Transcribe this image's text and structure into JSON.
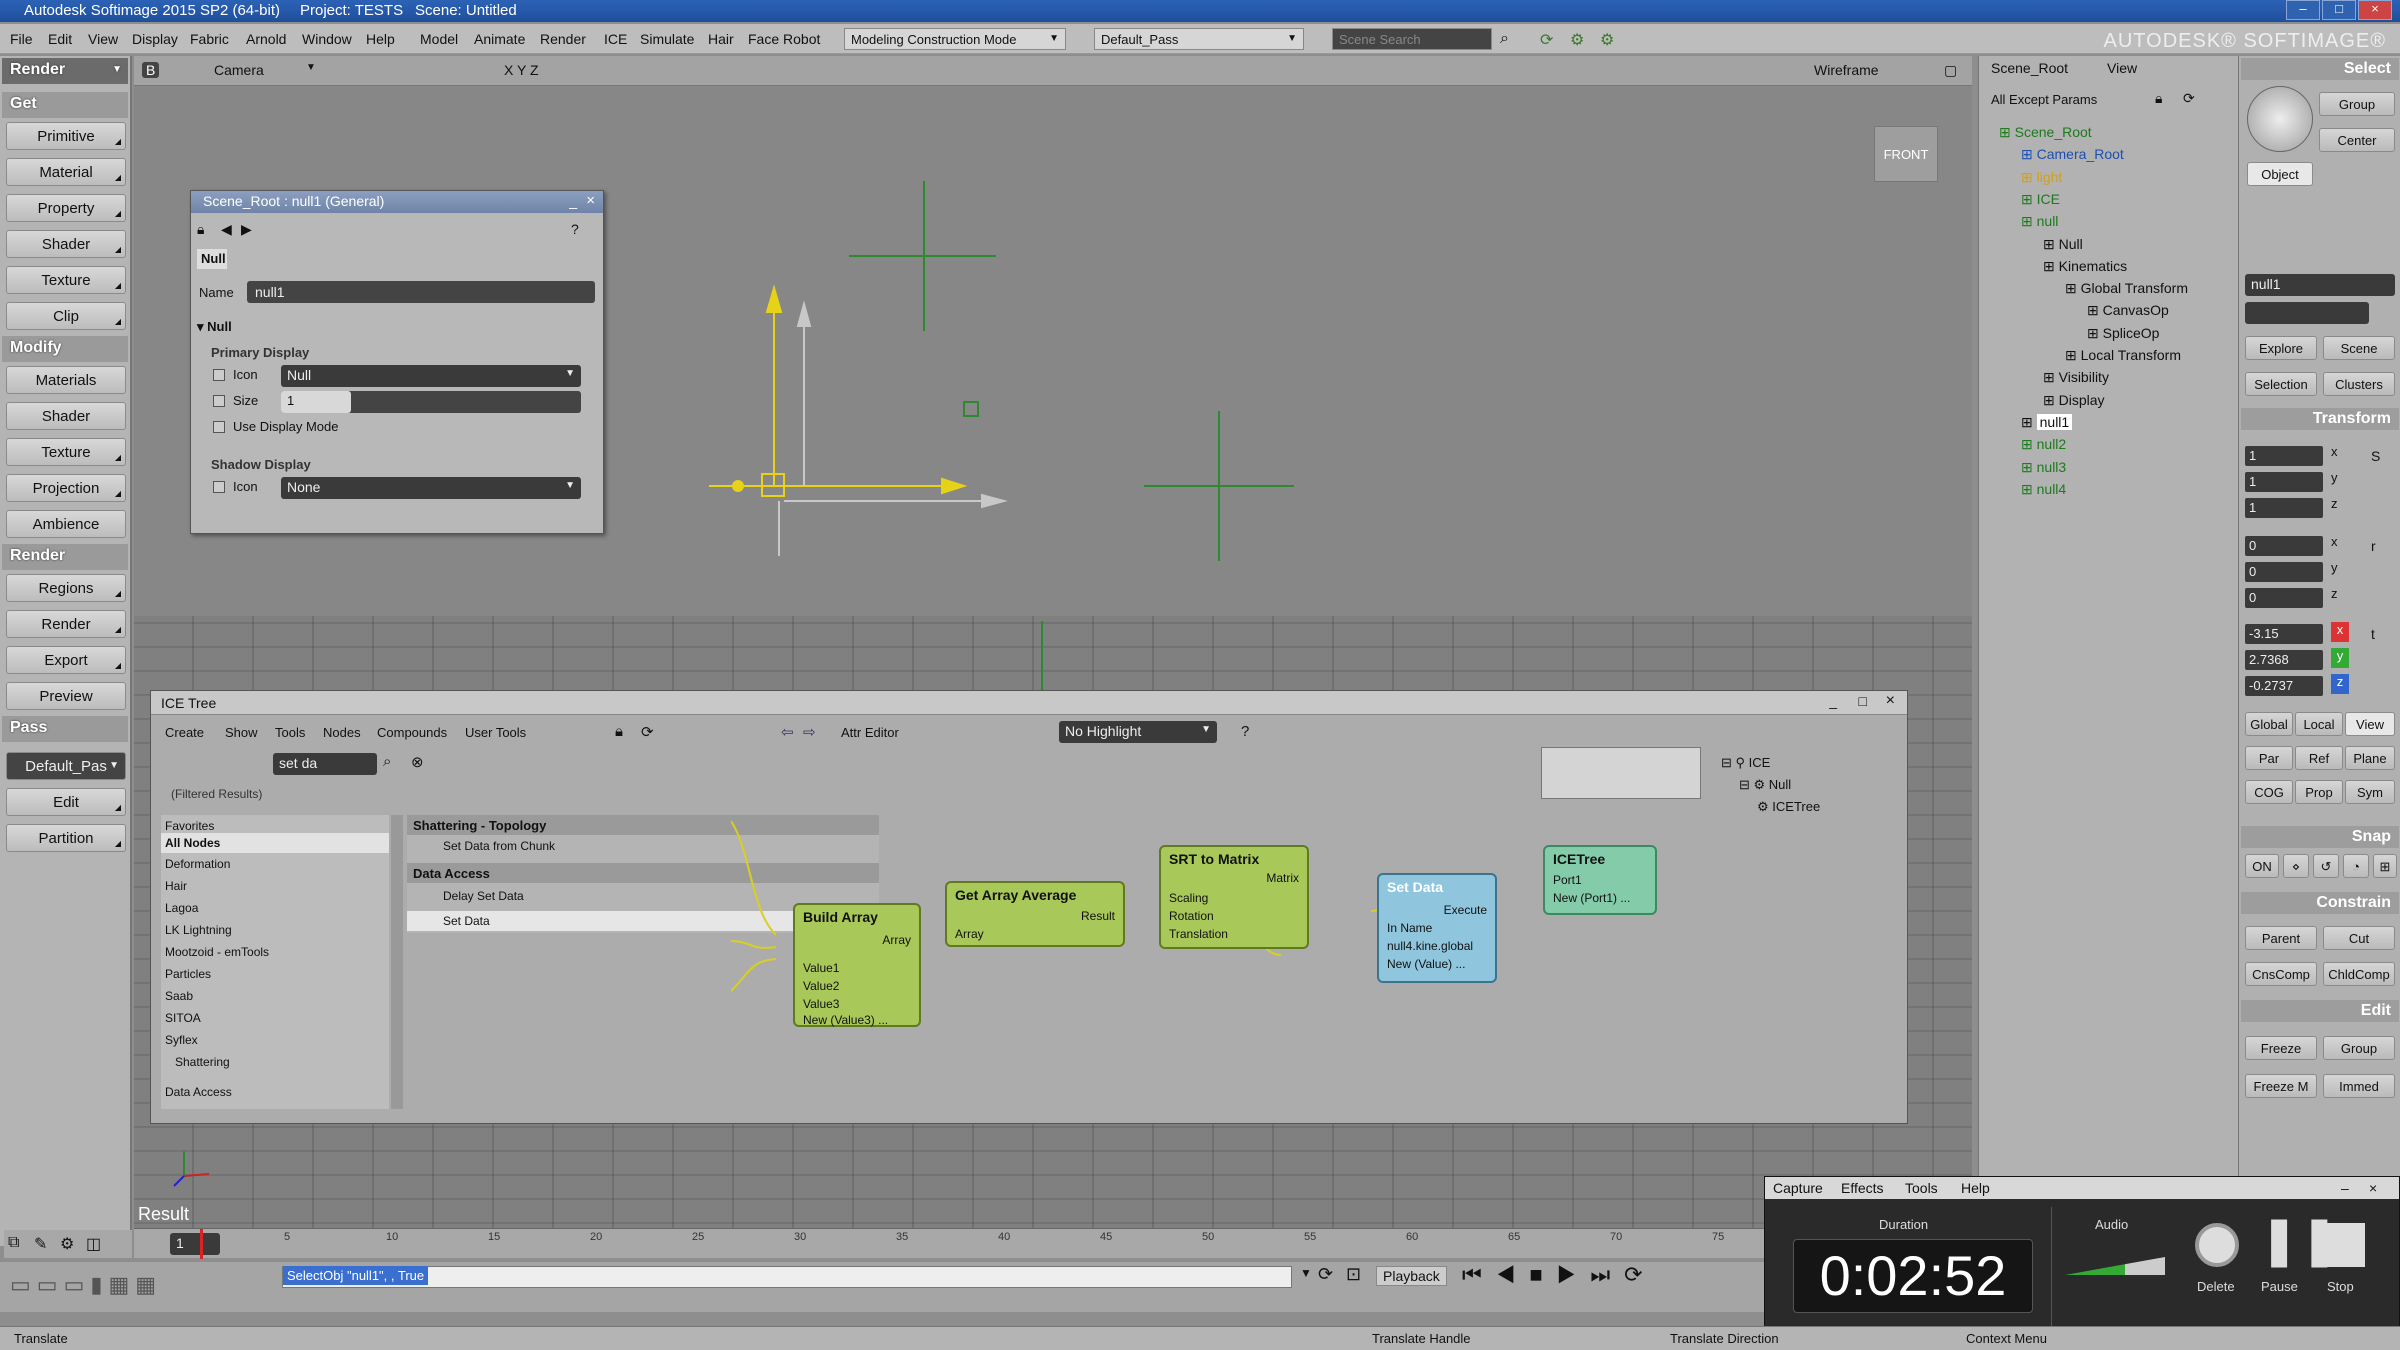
{
  "app": {
    "title": "Autodesk Softimage 2015 SP2 (64-bit)",
    "project": "Project: TESTS",
    "scene": "Scene: Untitled",
    "brand": "AUTODESK® SOFTIMAGE®"
  },
  "menubar": {
    "items": [
      "File",
      "Edit",
      "View",
      "Display",
      "Fabric",
      "Arnold",
      "Window",
      "Help",
      "Model",
      "Animate",
      "Render",
      "ICE",
      "Simulate",
      "Hair",
      "Face Robot"
    ],
    "construction_mode": "Modeling Construction Mode",
    "pass": "Default_Pass",
    "search_placeholder": "Scene Search"
  },
  "left_panel": {
    "mode": "Render",
    "sections": [
      {
        "title": "Get",
        "buttons": [
          "Primitive",
          "Material",
          "Property",
          "Shader",
          "Texture",
          "Clip"
        ]
      },
      {
        "title": "Modify",
        "buttons": [
          "Materials",
          "Shader",
          "Texture",
          "Projection",
          "Ambience"
        ]
      },
      {
        "title": "Render",
        "buttons": [
          "Regions",
          "Render",
          "Export",
          "Preview"
        ]
      },
      {
        "title": "Pass",
        "buttons": [
          "Default_Pas",
          "Edit",
          "Partition"
        ]
      }
    ]
  },
  "viewport": {
    "toolbar_label": "B",
    "camera": "Camera",
    "axes": "X Y Z",
    "shading": "Wireframe",
    "view_cube": "FRONT",
    "result_label": "Result"
  },
  "property_panel": {
    "title": "Scene_Root : null1 (General)",
    "tab": "Null",
    "name_label": "Name",
    "name_value": "null1",
    "section": "Null",
    "primary_display": "Primary Display",
    "icon_label": "Icon",
    "icon_value": "Null",
    "size_label": "Size",
    "size_value": "1",
    "use_display_mode": "Use Display Mode",
    "shadow_display": "Shadow Display",
    "shadow_icon_label": "Icon",
    "shadow_icon_value": "None"
  },
  "ice_tree": {
    "title": "ICE Tree",
    "menu": [
      "Create",
      "Show",
      "Tools",
      "Nodes",
      "Compounds",
      "User Tools"
    ],
    "attr_editor": "Attr Editor",
    "highlight": "No Highlight",
    "search_value": "set da",
    "filtered": "(Filtered Results)",
    "categories": [
      "Favorites",
      "All Nodes",
      "Deformation",
      "Hair",
      "Lagoa",
      "LK Lightning",
      "Mootzoid - emTools",
      "Particles",
      "Saab",
      "SITOA",
      "Syflex",
      "Shattering",
      "Data Access"
    ],
    "selected_category": "All Nodes",
    "results": [
      {
        "group": "Shattering - Topology",
        "items": [
          "Set Data from Chunk"
        ]
      },
      {
        "group": "Data Access",
        "items": [
          "Delay Set Data",
          "Set Data"
        ]
      }
    ],
    "nodes": {
      "build_array": {
        "title": "Build Array",
        "out": "Array",
        "ins": [
          "Value1",
          "Value2",
          "Value3",
          "New (Value3) ..."
        ]
      },
      "get_array_average": {
        "title": "Get Array Average",
        "out": "Result",
        "ins": [
          "Array"
        ]
      },
      "srt_to_matrix": {
        "title": "SRT to Matrix",
        "out": "Matrix",
        "ins": [
          "Scaling",
          "Rotation",
          "Translation"
        ]
      },
      "set_data": {
        "title": "Set Data",
        "out": "Execute",
        "ins": [
          "In Name",
          "null4.kine.global",
          "New (Value) ..."
        ]
      },
      "icetree": {
        "title": "ICETree",
        "ins": [
          "Port1",
          "New (Port1) ..."
        ]
      }
    },
    "mini_tree": [
      "ICE",
      "Null",
      "ICETree"
    ]
  },
  "explorer": {
    "scope": "Scene_Root",
    "view": "View",
    "filter": "All Except Params",
    "items": [
      {
        "label": "Scene_Root",
        "level": 0,
        "color": "#1d7a1d"
      },
      {
        "label": "Camera_Root",
        "level": 1,
        "color": "#1d4fb0"
      },
      {
        "label": "light",
        "level": 1,
        "color": "#d4a010"
      },
      {
        "label": "ICE",
        "level": 1,
        "color": "#1d7a1d"
      },
      {
        "label": "null",
        "level": 1,
        "color": "#1d7a1d"
      },
      {
        "label": "Null",
        "level": 2,
        "color": "#111111"
      },
      {
        "label": "Kinematics",
        "level": 2,
        "color": "#111111"
      },
      {
        "label": "Global Transform",
        "level": 3,
        "color": "#111111"
      },
      {
        "label": "CanvasOp",
        "level": 4,
        "color": "#111111"
      },
      {
        "label": "SpliceOp",
        "level": 4,
        "color": "#111111"
      },
      {
        "label": "Local Transform",
        "level": 3,
        "color": "#111111"
      },
      {
        "label": "Visibility",
        "level": 2,
        "color": "#111111"
      },
      {
        "label": "Display",
        "level": 2,
        "color": "#111111"
      },
      {
        "label": "null1",
        "level": 1,
        "color": "#111111"
      },
      {
        "label": "null2",
        "level": 1,
        "color": "#1d7a1d"
      },
      {
        "label": "null3",
        "level": 1,
        "color": "#1d7a1d"
      },
      {
        "label": "null4",
        "level": 1,
        "color": "#1d7a1d"
      }
    ]
  },
  "mcp": {
    "select": "Select",
    "group": "Group",
    "center": "Center",
    "object": "Object",
    "object_name": "null1",
    "explore": "Explore",
    "scene": "Scene",
    "selection": "Selection",
    "clusters": "Clusters",
    "transform": "Transform",
    "scale": [
      "1",
      "1",
      "1"
    ],
    "rotate": [
      "0",
      "0",
      "0"
    ],
    "translate": [
      "-3.15",
      "2.7368",
      "-0.2737"
    ],
    "axes": [
      "x",
      "y",
      "z"
    ],
    "ref_modes": [
      "Global",
      "Local",
      "View"
    ],
    "ref_modes2": [
      "Par",
      "Ref",
      "Plane"
    ],
    "ref_modes3": [
      "COG",
      "Prop",
      "Sym"
    ],
    "snap": "Snap",
    "snap_on": "ON",
    "constrain": "Constrain",
    "constrain_btns": [
      "Parent",
      "Cut",
      "CnsComp",
      "ChldComp"
    ],
    "edit": "Edit",
    "edit_btns": [
      "Freeze",
      "Group",
      "Freeze M",
      "Immed"
    ]
  },
  "timeline": {
    "frame": "1",
    "ticks": [
      "5",
      "10",
      "15",
      "20",
      "25",
      "30",
      "35",
      "40",
      "45",
      "50",
      "55",
      "60",
      "65",
      "70",
      "75"
    ],
    "command": "SelectObj \"null1\", , True",
    "playback": "Playback"
  },
  "capture": {
    "menu": [
      "Capture",
      "Effects",
      "Tools",
      "Help"
    ],
    "duration_label": "Duration",
    "duration": "0:02:52",
    "audio_label": "Audio",
    "delete": "Delete",
    "pause": "Pause",
    "stop": "Stop"
  },
  "status": {
    "left": "Translate",
    "mid": "Translate Handle",
    "mid2": "Translate Direction",
    "right": "Context Menu"
  }
}
